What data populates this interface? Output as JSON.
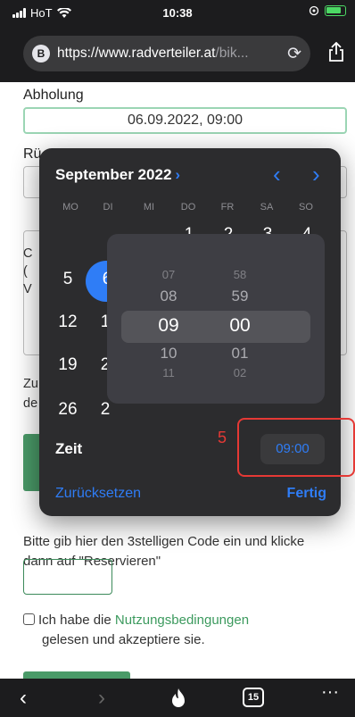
{
  "status_bar": {
    "carrier": "HoT",
    "time": "10:38"
  },
  "url_bar": {
    "badge": "B",
    "url_main": "https://www.radverteiler.at",
    "url_tail": "/bik..."
  },
  "form": {
    "pickup_label": "Abholung",
    "pickup_value": "06.09.2022, 09:00",
    "return_label_partial": "Rü",
    "partial_lines": [
      "C",
      "(",
      "V"
    ],
    "partial_zu": "Zu",
    "partial_de": "de",
    "code_instruction": "Bitte gib hier den 3stelligen Code ein und klicke dann auf \"Reservieren\"",
    "terms_prefix": "Ich habe die ",
    "terms_link": "Nutzungsbedingungen",
    "terms_suffix": "gelesen und akzeptiere sie."
  },
  "picker": {
    "month_title": "September 2022",
    "weekdays": [
      "MO",
      "DI",
      "MI",
      "DO",
      "FR",
      "SA",
      "SO"
    ],
    "visible_days": [
      "1",
      "2",
      "3",
      "4",
      "5",
      "6",
      "12",
      "1",
      "19",
      "2",
      "26",
      "2"
    ],
    "hours": [
      "07",
      "08",
      "09",
      "10",
      "11"
    ],
    "minutes": [
      "58",
      "59",
      "00",
      "01",
      "02"
    ],
    "time_label": "Zeit",
    "time_value": "09:00",
    "reset_label": "Zurücksetzen",
    "done_label": "Fertig"
  },
  "annotation": {
    "number": "5"
  },
  "toolbar": {
    "tab_count": "15"
  },
  "colors": {
    "accent_blue": "#2f7df6",
    "brand_green": "#4a9a68",
    "annotation_red": "#e53935"
  }
}
